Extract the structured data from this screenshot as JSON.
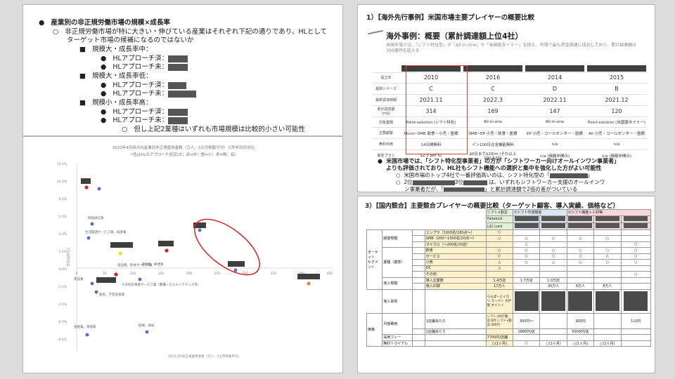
{
  "text_panel": {
    "b1": "産業別の非正規労働市場の規模×成長率",
    "b2a": "非正規労働市場が特に大きい・伸びている産業はそれぞれ下記の通りであり、HLとして",
    "b2b": "ターゲット市場の候補になるのではないか",
    "g1": "規模大・成長率中：",
    "g1_a": "HLアプローチ済：",
    "g1_b": "HLアプローチ未：",
    "g2": "規模大・成長率低：",
    "g2_a": "HLアプローチ済：",
    "g2_b": "HLアプローチ未：",
    "g3": "規模小・成長率高：",
    "g3_a": "HLアプローチ済：",
    "g3_b": "HLアプローチ未：",
    "note": "但し上記2業種はいずれも市場規模は比較的小さい可能性"
  },
  "scatter": {
    "title": "2023年4月時点の産業別非正規雇用者数（万人，3カ月移動平均）と昨年同月対比",
    "subtitle": "*色はHLのアプローチ状況(大：赤⇔中：橙⇔小：青⇔無：有)",
    "xlabel": "2023.4の非正規雇用者数（万人，3カ月移動平均）",
    "ylabel": "昨年同月対比",
    "yticks": [
      "12.0%",
      "10.0%",
      "8.0%",
      "6.0%",
      "4.0%",
      "2.0%",
      "0.0%",
      "-2.0%",
      "-4.0%",
      "-6.0%",
      "-8.0%"
    ],
    "xticks": [
      "0",
      "50",
      "100",
      "150",
      "200",
      "250",
      "300",
      "350",
      "400",
      "450"
    ],
    "labels": {
      "p1": "情報通信業",
      "p2": "生活関連サービス業，娯楽業",
      "p3": "宿泊業，飲食サービス業",
      "p4": "運輸業，郵便業",
      "p5": "建設業",
      "p6": "その他の事業サービス業（警備・ビルメンテナンス等）",
      "p7": "金融業，保険業",
      "p8": "医療，福祉",
      "p9": "教育，学習支援業"
    }
  },
  "us_panel": {
    "title": "1）【海外先行事例】米国市場主要プレイヤーの概要比較",
    "subtitle": "海外事例：概要（累計調達額上位4社）",
    "desc": "米国市場では、「シフト特化型」が「All-in-One」や「米国版タイミー」を抑え、市場で最も資金調達に成功しており、累計調達額は300億円を超える",
    "rows": [
      {
        "label": "設立年",
        "vals": [
          "2010",
          "2016",
          "2014",
          "2015"
        ],
        "big": true
      },
      {
        "label": "最新シリーズ",
        "vals": [
          "C",
          "C",
          "D",
          "B"
        ],
        "big": true
      },
      {
        "label": "最新調達時期",
        "vals": [
          "2021.11",
          "2022.3",
          "2022.11",
          "2021.12"
        ],
        "big": true
      },
      {
        "label": "累計調達額(m$)",
        "vals": [
          "314",
          "169",
          "147",
          "120"
        ],
        "big": true
      },
      {
        "label": "対象業務",
        "vals": [
          "Point-solution (シフト特化)",
          "All-in-one",
          "All-in-one",
          "Point-solution (米国版タイミー)"
        ],
        "big": false
      },
      {
        "label": "主要顧客",
        "vals": [
          "Micro~SMB 飲食・小売・医療",
          "SMB~EP 小売・飲食・医療",
          "EP 小売・コールセンター・医療",
          "All 小売・コールセンター・医療"
        ],
        "big": false
      },
      {
        "label": "無料利用",
        "vals": [
          "14日間無料",
          "イン100日は全機能無料",
          "n/a",
          "n/a"
        ],
        "big": false
      },
      {
        "label": "最安プラン",
        "vals": [
          "$2.5 per ID",
          "$0日まで$29/m (それ以上$90.5/ID)",
          "n/a (価格非開示)",
          "n/a (価格非開示)"
        ],
        "big": false
      }
    ],
    "bullet1a": "米国市場では、「シフト特化型事業者」の方が「シフトワーカー向けオールインワン事業者」",
    "bullet1b": "よりも評価されており、HL社もシフト機能への選択と集中を強化した方がよい可能性",
    "bullet2": "米国市場のトップ4社で一番評価高いのは、シフト特化型の",
    "bullet3a": "2位",
    "bullet3b": "3位",
    "bullet3c": "は、いずれもシフトワーカー支援のオールインワ",
    "bullet3d": "ン事業者だが、",
    "bullet3e": "と累計調達額で2倍の差がついている"
  },
  "jp_panel": {
    "title": "3）【国内競合】主要競合プレイヤーの概要比較（ターゲット顧客、導入実績、価格など）",
    "hdr_shift": "シフト×勤怠",
    "hdr_shift_only": "①シフト作成機能",
    "hdr_shift_talent": "②シフト機能＋人材等",
    "hl1": "Hataluck",
    "hl2": "(占) Luck",
    "cat_target": "ターゲット\nセグメント",
    "cat_price": "価格",
    "sub_size": "顧客規模",
    "sub_industry": "業種（業態）",
    "sub_intro": "導入規模",
    "sub_case": "導入事例",
    "sub_monthly": "月額費用",
    "r_enterprise": "エンプラ（1000名/180点～）",
    "r_smb": "SMB（200～1000名/20点～）",
    "r_micro": "マイクロ（～200名/20店）",
    "r_food": "飲食",
    "r_service": "サービス",
    "r_retail": "小売",
    "r_dc": "DC",
    "r_other": "その他",
    "r_companies": "導入企業数",
    "r_ids": "導入ID数",
    "r_per_store": "1店舗あたり",
    "r_per_account": "1店舗あたり",
    "r_fee": "採用フィー",
    "r_trial": "無料トライアル",
    "v_companies": [
      "1.4万店",
      "1.7万店",
      "1.0万店"
    ],
    "v_ids": [
      "17万人",
      "",
      "30万人",
      "6万人",
      "8万人"
    ],
    "v_case": "ららぽーとイカリ スーパー 大戸屋 オイシイ",
    "v_monthly1": "シフト:20円 勤怠:0円 シフト+勤怠:400円",
    "v_monthly2": "300円～",
    "v_monthly3": "300円",
    "v_monthly4": "110円",
    "v_acc1": "2880円/店",
    "v_acc2": "5000円/店",
    "v_fee": "7700円/店舗",
    "v_trial": [
      "○(1ヶ月)",
      "○",
      "○(1ヶ月)",
      "○(1ヶ月)",
      "○(1ヶ月)"
    ],
    "circle": "○",
    "tri": "△"
  }
}
